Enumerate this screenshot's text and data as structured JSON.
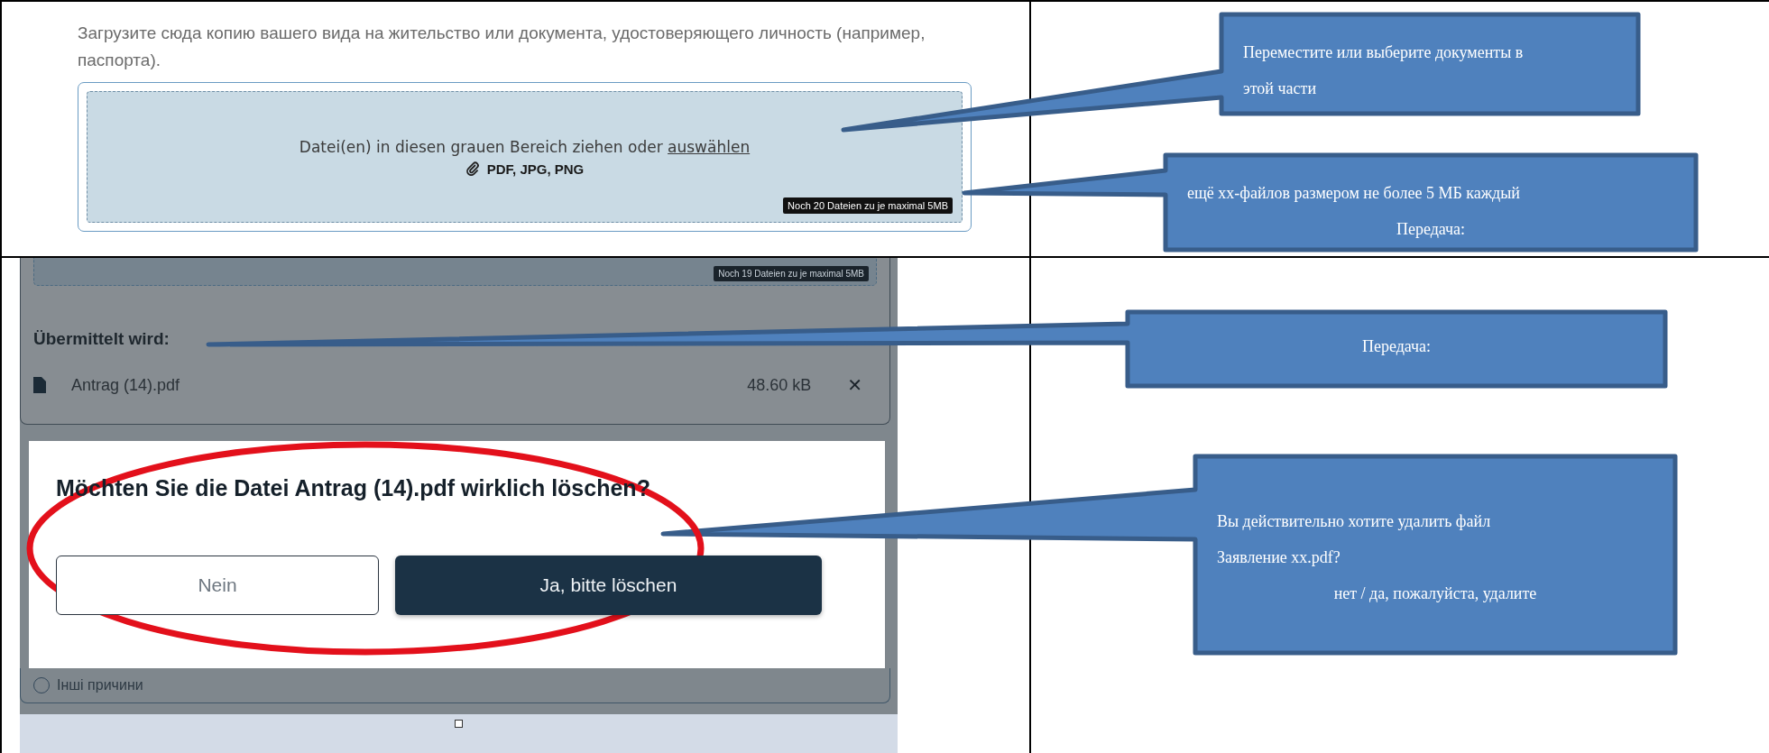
{
  "upload_screen": {
    "instruction": "Загрузите сюда копию вашего вида на жительство или документа, удостоверяющего личность (например, паспорта).",
    "dropzone": {
      "prompt": "Datei(en) in diesen grauen Bereich ziehen oder",
      "link": "auswählen",
      "formats": "PDF, JPG, PNG",
      "limit": "Noch 20 Dateien zu je maximal 5MB"
    }
  },
  "dialog_screen": {
    "limit": "Noch 19 Dateien zu je maximal 5MB",
    "transfer_heading": "Übermittelt wird:",
    "files": [
      {
        "name": "Antrag (14).pdf",
        "size": "48.60 kB",
        "remove": "✕"
      }
    ],
    "dialog": {
      "question": "Möchten Sie die Datei Antrag (14).pdf wirklich löschen?",
      "buttons": [
        {
          "label": "Nein",
          "kind": "secondary"
        },
        {
          "label": "Ja, bitte löschen",
          "kind": "primary"
        }
      ]
    },
    "background_option": {
      "label": "Інші причини",
      "checked": false
    }
  },
  "callouts": [
    {
      "lines": [
        {
          "text": "Переместите или выберите документы в",
          "kind": "indented"
        },
        {
          "text": "этой части",
          "kind": "indented"
        }
      ]
    },
    {
      "lines": [
        {
          "text": "ещё хх-файлов размером не более 5 МБ каждый",
          "kind": "indented"
        },
        {
          "text": "Передача:",
          "kind": "centered"
        }
      ]
    },
    {
      "lines": [
        {
          "text": "Передача:",
          "kind": "centered"
        }
      ]
    },
    {
      "lines": [
        {
          "text": "Вы действительно хотите удалить файл",
          "kind": "indented"
        },
        {
          "text": "Заявление хх.pdf?",
          "kind": "indented"
        },
        {
          "text": "нет / да, пожалуйста, удалите",
          "kind": "centered"
        }
      ]
    }
  ]
}
